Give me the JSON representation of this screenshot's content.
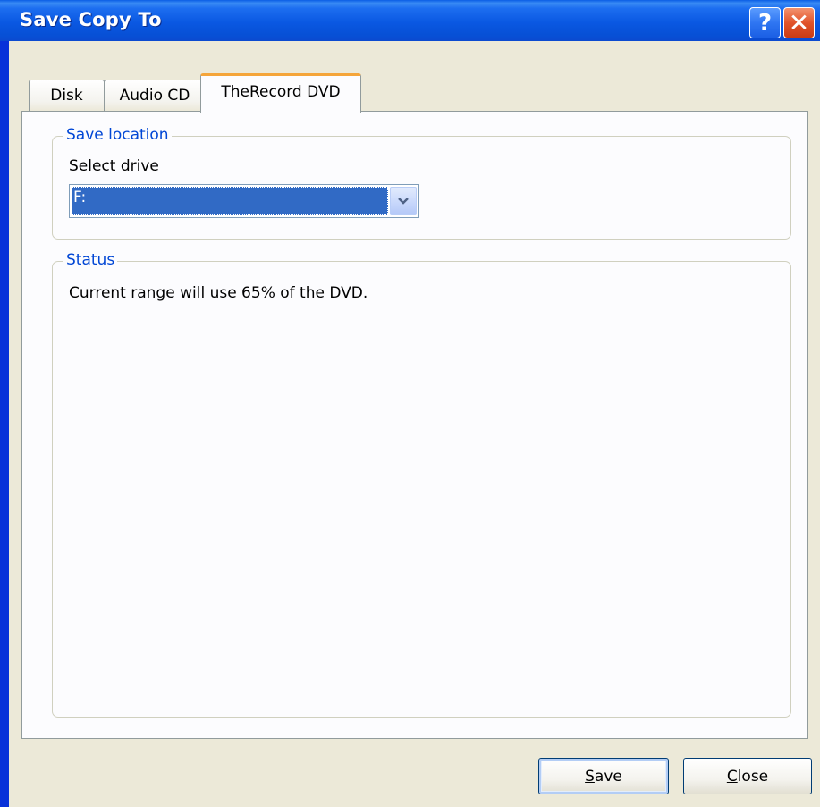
{
  "window": {
    "title": "Save Copy To",
    "help_glyph": "?",
    "close_glyph": "✕"
  },
  "tabs": [
    {
      "label": "Disk",
      "selected": false
    },
    {
      "label": "Audio CD",
      "selected": false
    },
    {
      "label": "TheRecord DVD",
      "selected": true
    }
  ],
  "save_location": {
    "legend": "Save location",
    "select_label": "Select drive",
    "drive_value": "F:"
  },
  "status": {
    "legend": "Status",
    "message": "Current range will use 65% of the DVD."
  },
  "buttons": {
    "save_mnemonic": "S",
    "save_rest": "ave",
    "close_mnemonic": "C",
    "close_rest": "lose"
  },
  "icons": {
    "dropdown": "chevron-down-icon"
  },
  "colors": {
    "title_bar": "#0a58e2",
    "dialog_face": "#ece9d8",
    "legend_text": "#0046d5",
    "selection": "#316ac5",
    "active_tab_accent": "#f5a53a",
    "close_button": "#e1542b"
  }
}
